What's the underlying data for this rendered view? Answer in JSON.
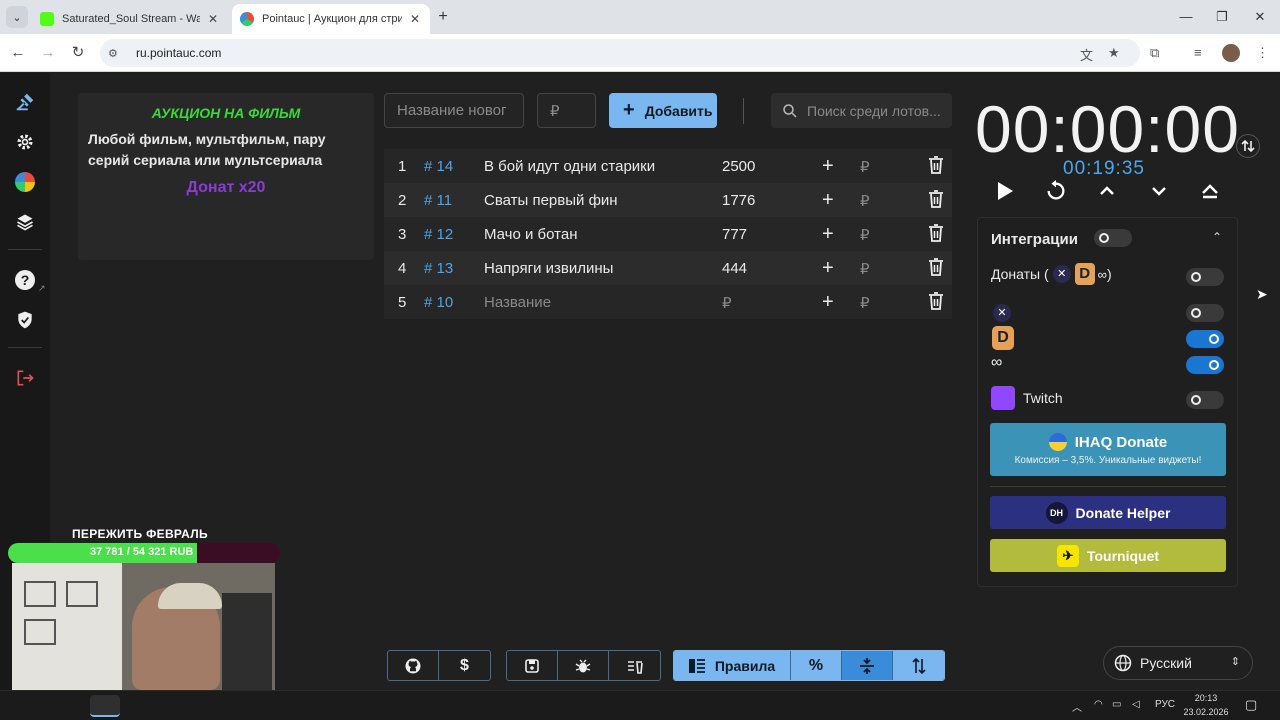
{
  "browser": {
    "tabs": [
      {
        "title": "Saturated_Soul Stream - Watch",
        "favicon_color": "#53fc18",
        "active": false
      },
      {
        "title": "Pointauc | Аукцион для стриме",
        "favicon_color": "#3a8bd8",
        "active": true
      }
    ],
    "url": "ru.pointauc.com"
  },
  "info_card": {
    "title": "АУКЦИОН НА ФИЛЬМ",
    "body": "Любой фильм, мультфильм, пару серий сериала или мультсериала",
    "donate": "Донат x20"
  },
  "new_lot": {
    "name_placeholder": "Название новог",
    "amount_placeholder": "₽",
    "add_label": "Добавить"
  },
  "search": {
    "placeholder": "Поиск среди лотов..."
  },
  "lots": [
    {
      "num": "1",
      "id": "# 14",
      "name": "В бой идут одни старики",
      "amount": "2500"
    },
    {
      "num": "2",
      "id": "# 11",
      "name": "Сваты первый фин",
      "amount": "1776"
    },
    {
      "num": "3",
      "id": "# 12",
      "name": "Мачо и ботан",
      "amount": "777"
    },
    {
      "num": "4",
      "id": "# 13",
      "name": "Напряги извилины",
      "amount": "444"
    },
    {
      "num": "5",
      "id": "# 10",
      "name": "Название",
      "amount": "₽"
    }
  ],
  "currency": "₽",
  "timer": {
    "main": "00:00:00",
    "sub": "00:19:35"
  },
  "integrations": {
    "title": "Интеграции",
    "donations_label": "Донаты (",
    "donations_close": ")",
    "enabled_flags": {
      "master": false,
      "donations": false,
      "x": false,
      "donatepay": true,
      "donatello": true,
      "twitch": false
    },
    "twitch_label": "Twitch",
    "ihaq_title": "IHAQ Donate",
    "ihaq_subtitle": "Комиссия – 3,5%. Уникальные виджеты!",
    "donate_helper": "Donate Helper",
    "donate_helper_badge": "DH",
    "tourniquet": "Tourniquet"
  },
  "colors": {
    "accent": "#7ab6ef",
    "blue_text": "#4da6e8",
    "green": "#3bd83b",
    "purple": "#8a3bd8",
    "ihaq": "#3b93b8",
    "donate_helper": "#2b3180",
    "tourniquet": "#b3bb3f"
  },
  "toolbar": {
    "rules_label": "Правила",
    "percent_label": "%"
  },
  "language": "Русский",
  "stream_overlay": {
    "title": "ПЕРЕЖИТЬ ФЕВРАЛЬ",
    "progress_text": "37 781 / 54 321 RUB",
    "progress_fraction": 0.696
  },
  "taskbar": {
    "lang": "РУС",
    "time": "20:13",
    "date": "23.02.2026"
  }
}
